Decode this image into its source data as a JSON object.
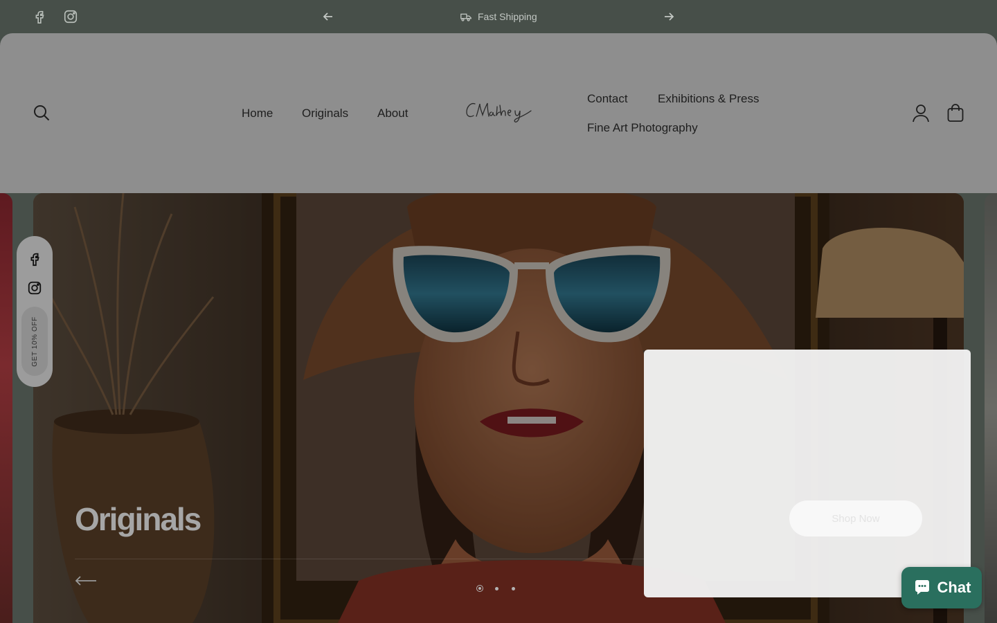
{
  "announcement": {
    "message": "Fast Shipping",
    "icons": [
      "facebook-icon",
      "instagram-icon",
      "arrow-left-icon",
      "arrow-right-icon",
      "truck-icon"
    ]
  },
  "header": {
    "nav_left": [
      "Home",
      "Originals",
      "About"
    ],
    "nav_right": [
      "Contact",
      "Exhibitions & Press",
      "Fine Art Photography"
    ],
    "icons": [
      "search-icon",
      "account-icon",
      "cart-icon"
    ]
  },
  "hero": {
    "title": "Originals",
    "slides_total": 3,
    "active_slide": 1
  },
  "side_rail": {
    "promo": "GET 10% OFF",
    "icons": [
      "facebook-icon",
      "instagram-icon"
    ]
  },
  "popup": {
    "button_label": "Shop Now"
  },
  "chat": {
    "label": "Chat"
  },
  "colors": {
    "announcement_bg": "#474f49",
    "header_bg": "#8e8e8e",
    "chat_bg": "#2a6f5e"
  }
}
